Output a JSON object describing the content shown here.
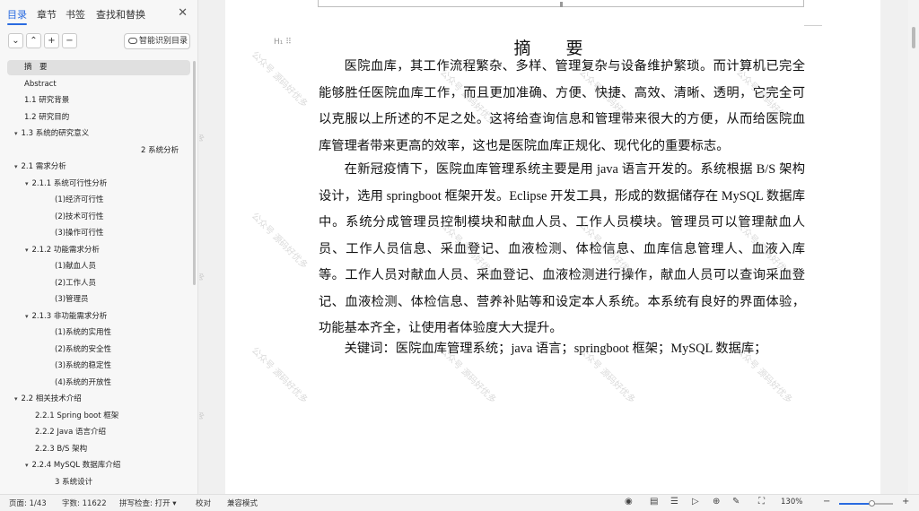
{
  "sidebar": {
    "tabs": [
      "目录",
      "章节",
      "书签",
      "查找和替换"
    ],
    "close_icon": "close-icon",
    "smart_toc_label": "智能识别目录",
    "toc": [
      {
        "label": "摘　要",
        "indent": 0,
        "arrow": false,
        "selected": true
      },
      {
        "label": "Abstract",
        "indent": 0,
        "arrow": false
      },
      {
        "label": "1.1  研究背景",
        "indent": 0,
        "arrow": false
      },
      {
        "label": "1.2  研究目的",
        "indent": 0,
        "arrow": false
      },
      {
        "label": "1.3    系统的研究意义",
        "indent": 0,
        "arrow": true
      },
      {
        "label": "2 系统分析",
        "indent": 3,
        "arrow": false
      },
      {
        "label": "2.1 需求分析",
        "indent": 0,
        "arrow": true
      },
      {
        "label": "2.1.1  系统可行性分析",
        "indent": 1,
        "arrow": true
      },
      {
        "label": "(1)经济可行性",
        "indent": 2,
        "arrow": false
      },
      {
        "label": "(2)技术可行性",
        "indent": 2,
        "arrow": false
      },
      {
        "label": "(3)操作可行性",
        "indent": 2,
        "arrow": false
      },
      {
        "label": "2.1.2  功能需求分析",
        "indent": 1,
        "arrow": true
      },
      {
        "label": "(1)献血人员",
        "indent": 2,
        "arrow": false
      },
      {
        "label": "(2)工作人员",
        "indent": 2,
        "arrow": false
      },
      {
        "label": "(3)管理员",
        "indent": 2,
        "arrow": false
      },
      {
        "label": "2.1.3  非功能需求分析",
        "indent": 1,
        "arrow": true
      },
      {
        "label": "(1)系统的实用性",
        "indent": 2,
        "arrow": false
      },
      {
        "label": "(2)系统的安全性",
        "indent": 2,
        "arrow": false
      },
      {
        "label": "(3)系统的稳定性",
        "indent": 2,
        "arrow": false
      },
      {
        "label": "(4)系统的开放性",
        "indent": 2,
        "arrow": false
      },
      {
        "label": "2.2 相关技术介绍",
        "indent": 0,
        "arrow": true
      },
      {
        "label": "2.2.1 Spring boot 框架",
        "indent": 1,
        "arrow": false
      },
      {
        "label": "2.2.2 Java 语言介绍",
        "indent": 1,
        "arrow": false
      },
      {
        "label": "2.2.3 B/S 架构",
        "indent": 1,
        "arrow": false
      },
      {
        "label": "2.2.4 MySQL  数据库介绍",
        "indent": 1,
        "arrow": true
      },
      {
        "label": "3  系统设计",
        "indent": 2,
        "arrow": false
      }
    ]
  },
  "document": {
    "title": "摘　要",
    "paragraphs": [
      "医院血库，其工作流程繁杂、多样、管理复杂与设备维护繁琐。而计算机已完全能够胜任医院血库工作，而且更加准确、方便、快捷、高效、清晰、透明，它完全可以克服以上所述的不足之处。这将给查询信息和管理带来很大的方便，从而给医院血库管理者带来更高的效率，这也是医院血库正规化、现代化的重要标志。",
      "在新冠疫情下，医院血库管理系统主要是用 java 语言开发的。系统根据 B/S 架构设计，选用 springboot 框架开发。Eclipse 开发工具，形成的数据储存在 MySQL 数据库中。系统分成管理员控制模块和献血人员、工作人员模块。管理员可以管理献血人员、工作人员信息、采血登记、血液检测、体检信息、血库信息管理人、血液入库等。工作人员对献血人员、采血登记、血液检测进行操作，献血人员可以查询采血登记、血液检测、体检信息、营养补贴等和设定本人系统。本系统有良好的界面体验，功能基本齐全，让使用者体验度大大提升。",
      "关键词：医院血库管理系统；java 语言；springboot 框架；MySQL 数据库；"
    ],
    "watermark": "公众号 源码好优多"
  },
  "statusbar": {
    "page": "页面: 1/43",
    "words": "字数: 11622",
    "spellcheck": "拼写检查: 打开",
    "proofread": "校对",
    "compat": "兼容模式",
    "zoom": "130%",
    "zoom_level": 0.62
  }
}
